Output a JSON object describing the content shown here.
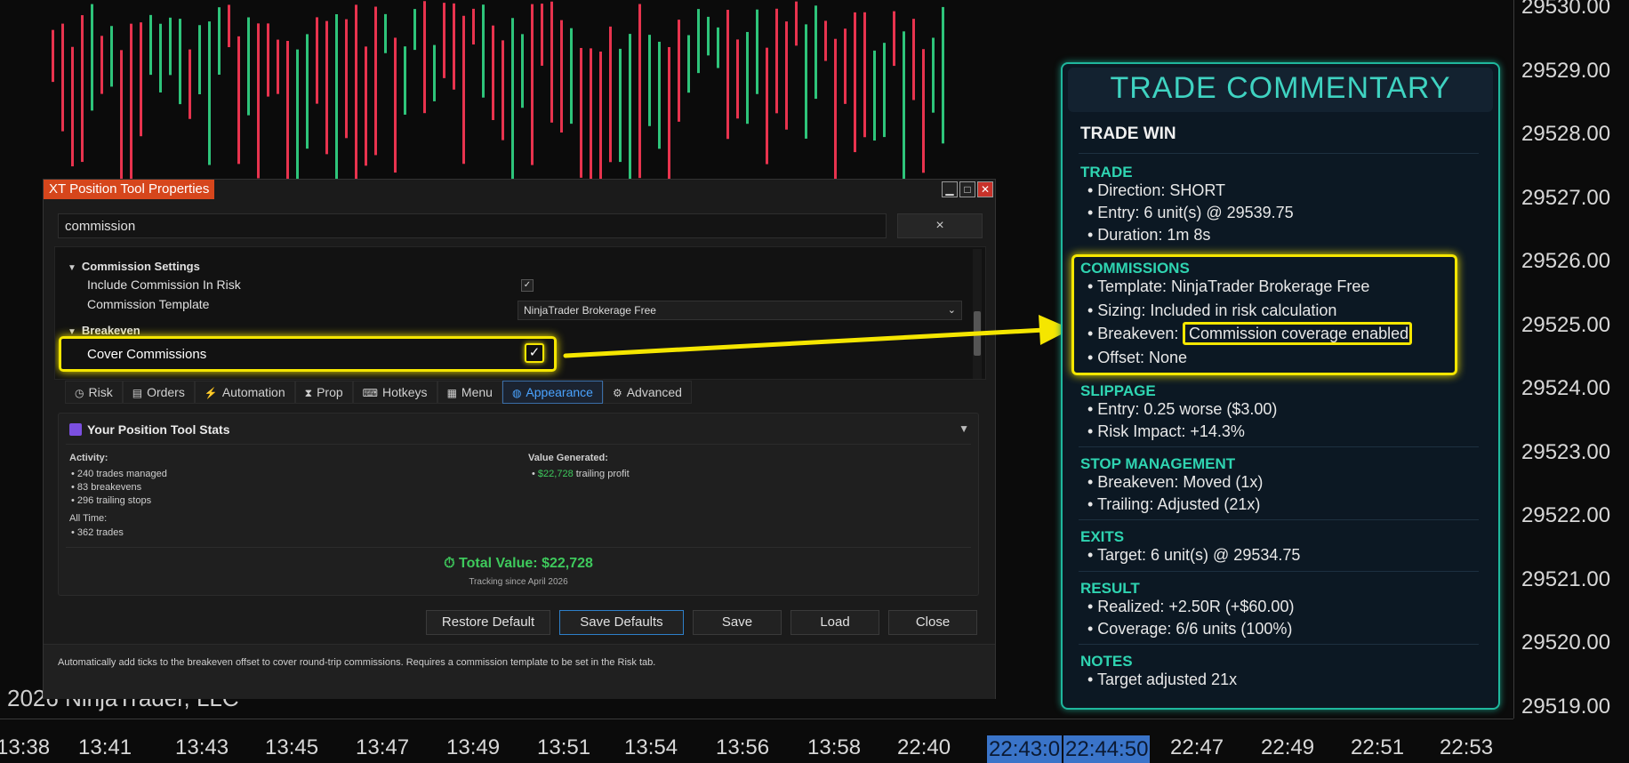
{
  "price_axis": {
    "labels": [
      "29530.00",
      "29529.00",
      "29528.00",
      "29527.00",
      "29526.00",
      "29525.00",
      "29524.00",
      "29523.00",
      "29522.00",
      "29521.00",
      "29520.00",
      "29519.00"
    ]
  },
  "time_axis": {
    "labels": [
      "13:38",
      "13:41",
      "13:43",
      "13:45",
      "13:47",
      "13:49",
      "13:51",
      "13:54",
      "13:56",
      "13:58",
      "22:40",
      "22:43:0",
      "22:44:50",
      "22:47",
      "22:49",
      "22:51",
      "22:53"
    ],
    "highlighted": [
      "22:43:0",
      "22:44:50"
    ]
  },
  "copyright": "2026 NinjaTrader, LLC",
  "colors": {
    "up": "#2ec47a",
    "down": "#e8334e",
    "accent": "#d6461c",
    "highlight": "#f5e600",
    "panel_border": "#1fb79d",
    "panel_heading": "#2fd4b1"
  },
  "dialog": {
    "title": "XT Position Tool Properties",
    "window_buttons": [
      "minimize",
      "maximize",
      "close"
    ],
    "search": {
      "value": "commission",
      "clear_glyph": "×"
    },
    "grid": {
      "cat_commission": "Commission Settings",
      "include_commission_label": "Include Commission In Risk",
      "include_commission_checked": true,
      "template_label": "Commission Template",
      "template_value": "NinjaTrader Brokerage Free",
      "cat_breakeven": "Breakeven",
      "cover_label": "Cover Commissions",
      "cover_checked": true,
      "check_glyph": "✓"
    },
    "tabs": [
      {
        "icon": "shield-icon",
        "glyph": "◷",
        "label": "Risk"
      },
      {
        "icon": "orders-icon",
        "glyph": "▤",
        "label": "Orders"
      },
      {
        "icon": "bolt-icon",
        "glyph": "⚡",
        "label": "Automation"
      },
      {
        "icon": "hourglass-icon",
        "glyph": "⧗",
        "label": "Prop"
      },
      {
        "icon": "keyboard-icon",
        "glyph": "⌨",
        "label": "Hotkeys"
      },
      {
        "icon": "menu-icon",
        "glyph": "▦",
        "label": "Menu"
      },
      {
        "icon": "palette-icon",
        "glyph": "◍",
        "label": "Appearance",
        "active": true
      },
      {
        "icon": "gear-icon",
        "glyph": "⚙",
        "label": "Advanced"
      }
    ],
    "stats": {
      "title": "Your Position Tool Stats",
      "toggle": "▼",
      "activity_label": "Activity:",
      "activity": [
        "• 240 trades managed",
        "• 83 breakevens",
        "• 296 trailing stops"
      ],
      "alltime_label": "All Time:",
      "alltime": [
        "• 362 trades"
      ],
      "value_label": "Value Generated:",
      "value_bullet": "•",
      "value_amount": "$22,728",
      "value_suffix": "trailing profit",
      "total_icon": "⏱",
      "total": "Total Value: $22,728",
      "tracking": "Tracking since April 2026"
    },
    "buttons": {
      "restore": "Restore Default",
      "save_defaults": "Save Defaults",
      "save": "Save",
      "load": "Load",
      "close": "Close"
    },
    "footer": "Automatically add ticks to the breakeven offset to cover round-trip commissions. Requires a commission template to be set in the Risk tab."
  },
  "commentary": {
    "title": "TRADE COMMENTARY",
    "result_heading": "TRADE WIN",
    "trade": {
      "heading": "TRADE",
      "direction": "• Direction:  SHORT",
      "entry": "• Entry:      6 unit(s) @ 29539.75",
      "duration": "• Duration:   1m 8s"
    },
    "commissions": {
      "heading": "COMMISSIONS",
      "template": "• Template:   NinjaTrader Brokerage Free",
      "sizing": "• Sizing:      Included in risk calculation",
      "breakeven_label": "• Breakeven:",
      "breakeven_value": "Commission coverage enabled",
      "offset": "• Offset:      None"
    },
    "slippage": {
      "heading": "SLIPPAGE",
      "entry": "• Entry:      0.25 worse ($3.00)",
      "risk": "• Risk Impact: +14.3%"
    },
    "stop": {
      "heading": "STOP MANAGEMENT",
      "breakeven": "• Breakeven:  Moved (1x)",
      "trailing": "• Trailing:   Adjusted (21x)"
    },
    "exits": {
      "heading": "EXITS",
      "target": "• Target:     6 unit(s) @ 29534.75"
    },
    "result": {
      "heading": "RESULT",
      "realized": "• Realized:   +2.50R (+$60.00)",
      "coverage": "• Coverage:   6/6 units (100%)"
    },
    "notes": {
      "heading": "NOTES",
      "text": "• Target adjusted 21x"
    }
  }
}
